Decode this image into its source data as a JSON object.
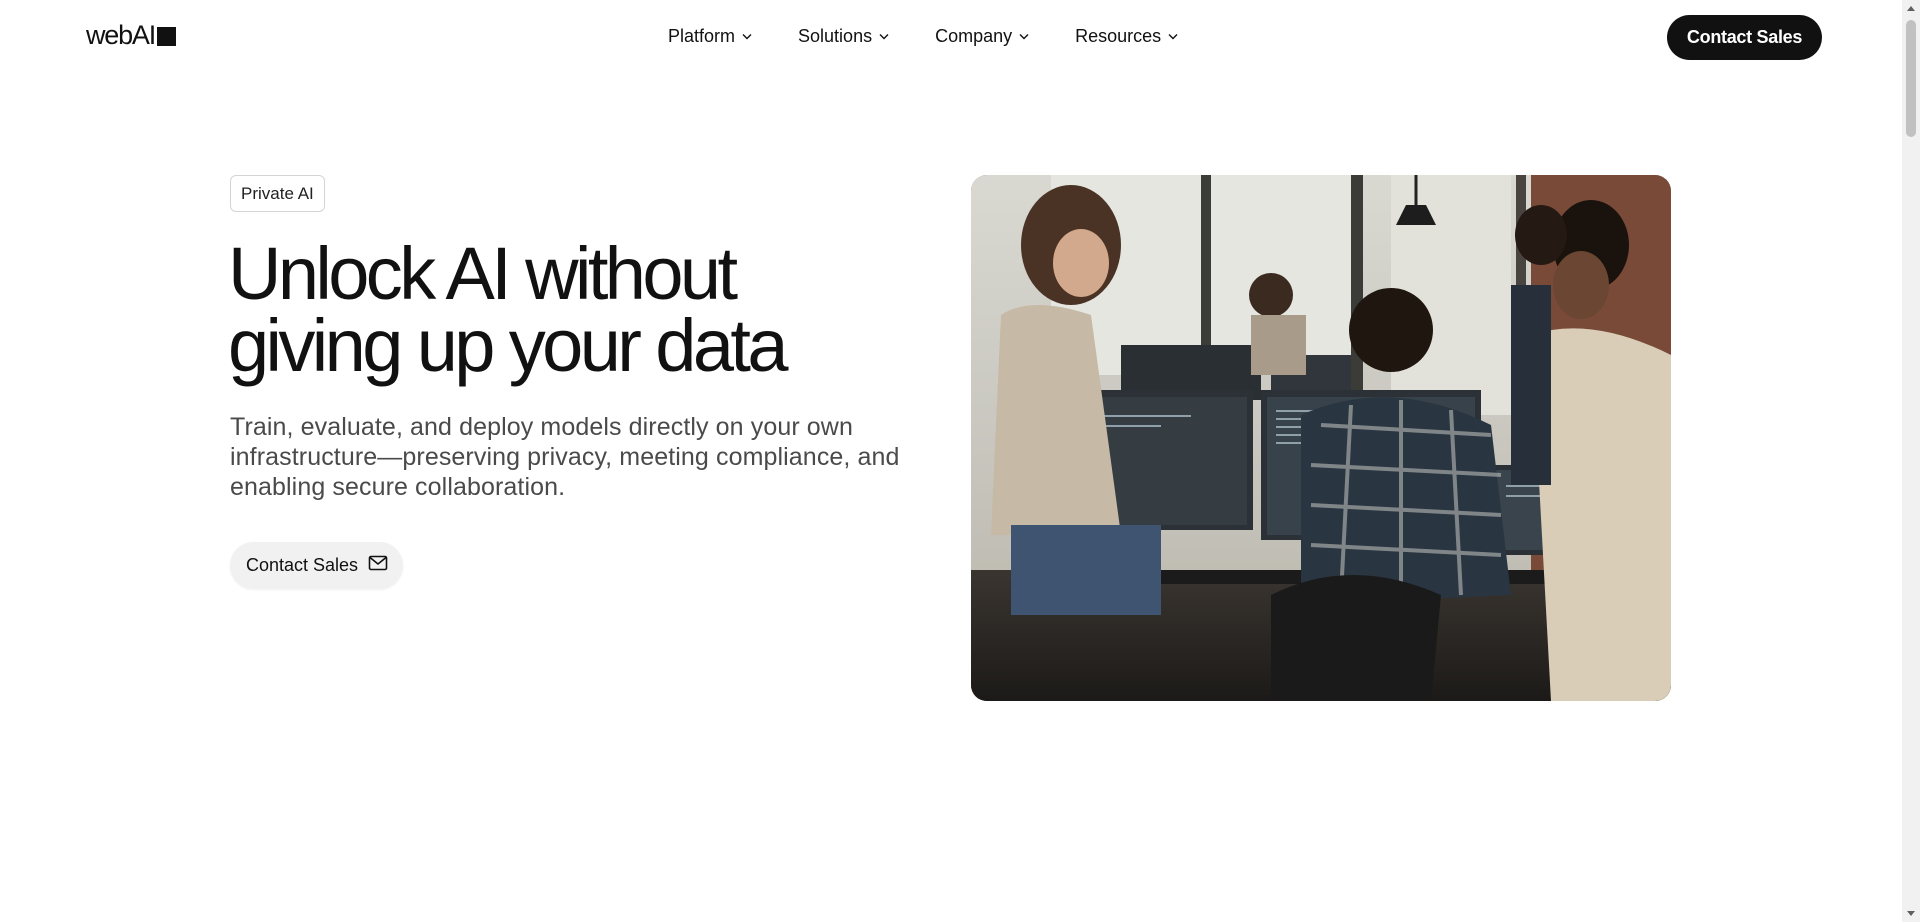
{
  "header": {
    "logo_text": "webAI",
    "nav": [
      {
        "label": "Platform"
      },
      {
        "label": "Solutions"
      },
      {
        "label": "Company"
      },
      {
        "label": "Resources"
      }
    ],
    "cta_label": "Contact Sales"
  },
  "hero": {
    "tag": "Private AI",
    "headline_line1": "Unlock AI without",
    "headline_line2": "giving up your data",
    "subhead_line1": "Train, evaluate, and deploy models directly on your own",
    "subhead_line2": "infrastructure—preserving privacy, meeting compliance, and",
    "subhead_line3": "enabling secure collaboration.",
    "cta_label": "Contact Sales",
    "cta_icon": "mail-icon",
    "image": "team-at-computer-monitors-photo"
  },
  "colors": {
    "primary": "#111111",
    "secondary_button_bg": "#f1f1f1",
    "body_text": "#4a4a4a"
  }
}
